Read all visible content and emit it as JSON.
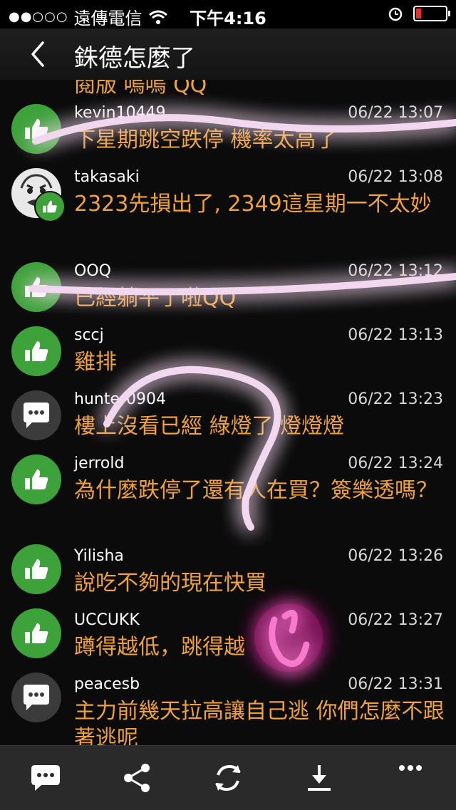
{
  "status_bar": {
    "carrier": "遠傳電信",
    "time": "下午4:16",
    "signal_dots": "●●○○○",
    "battery_color": "#e53030"
  },
  "header": {
    "title": "銖德怎麼了"
  },
  "colors": {
    "like_avatar": "#3ea23a",
    "chat_avatar": "#3b3b3b",
    "comment_text": "#f0a23a",
    "doodle_glow": "#ff1fb0"
  },
  "feed": {
    "partial_top_text": "閱版 嗚嗚 QQ",
    "comments": [
      {
        "user": "kevin10449",
        "time": "06/22 13:07",
        "text": "下星期跳空跌停 機率太高了",
        "avatar": "thumbs-up"
      },
      {
        "user": "takasaki",
        "time": "06/22 13:08",
        "text": "2323先損出了, 2349這星期一不太妙",
        "avatar": "photo-with-thumbs-up"
      },
      {
        "user": "OOQ",
        "time": "06/22 13:12",
        "text": "已經躺平了啦QQ",
        "avatar": "thumbs-up"
      },
      {
        "user": "sccj",
        "time": "06/22 13:13",
        "text": "雞排",
        "avatar": "thumbs-up"
      },
      {
        "user": "hunter0904",
        "time": "06/22 13:23",
        "text": "樓上沒看已經 綠燈了 燈燈燈",
        "avatar": "chat-bubble"
      },
      {
        "user": "jerrold",
        "time": "06/22 13:24",
        "text": "為什麼跌停了還有人在買？簽樂透嗎？",
        "avatar": "thumbs-up"
      },
      {
        "user": "Yilisha",
        "time": "06/22 13:26",
        "text": "說吃不夠的現在快買",
        "avatar": "thumbs-up"
      },
      {
        "user": "UCCUKK",
        "time": "06/22 13:27",
        "text": "蹲得越低，跳得越",
        "avatar": "thumbs-up"
      },
      {
        "user": "peacesb",
        "time": "06/22 13:31",
        "text": "主力前幾天拉高讓自己逃 你們怎麼不跟著逃呢",
        "avatar": "chat-bubble"
      }
    ]
  },
  "toolbar": {
    "buttons": [
      "comment-icon",
      "share-icon",
      "refresh-icon",
      "download-icon",
      "more-icon"
    ]
  }
}
